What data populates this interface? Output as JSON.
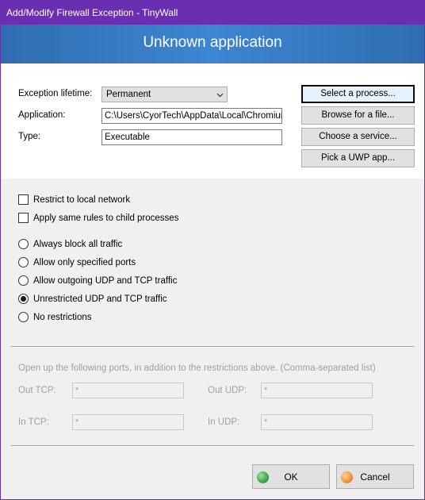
{
  "window": {
    "title": "Add/Modify Firewall Exception - TinyWall"
  },
  "banner": {
    "heading": "Unknown application"
  },
  "form": {
    "lifetime_label": "Exception lifetime:",
    "lifetime_value": "Permanent",
    "application_label": "Application:",
    "application_value": "C:\\Users\\CyorTech\\AppData\\Local\\Chromium",
    "type_label": "Type:",
    "type_value": "Executable"
  },
  "picker_buttons": {
    "select_process": "Select a process...",
    "browse_file": "Browse for a file...",
    "choose_service": "Choose a service...",
    "pick_uwp": "Pick a UWP app..."
  },
  "options": {
    "restrict_local": {
      "label": "Restrict to local network",
      "checked": false
    },
    "child_processes": {
      "label": "Apply same rules to child processes",
      "checked": false
    }
  },
  "traffic": {
    "always_block": "Always block all traffic",
    "specified_ports": "Allow only specified ports",
    "outgoing": "Allow outgoing UDP and TCP traffic",
    "unrestricted": "Unrestricted UDP and TCP traffic",
    "no_restrictions": "No restrictions",
    "selected": "unrestricted"
  },
  "ports": {
    "hint": "Open up the following ports, in addition to the restrictions above. (Comma-separated list)",
    "out_tcp_label": "Out TCP:",
    "out_tcp_value": "*",
    "out_udp_label": "Out UDP:",
    "out_udp_value": "*",
    "in_tcp_label": "In TCP:",
    "in_tcp_value": "*",
    "in_udp_label": "In UDP:",
    "in_udp_value": "*"
  },
  "footer": {
    "ok_label": "OK",
    "cancel_label": "Cancel"
  },
  "colors": {
    "titlebar": "#6a2eb0",
    "banner": "#3d86d1",
    "ok_icon": "#2e9b3a",
    "cancel_icon": "#e8862a"
  }
}
